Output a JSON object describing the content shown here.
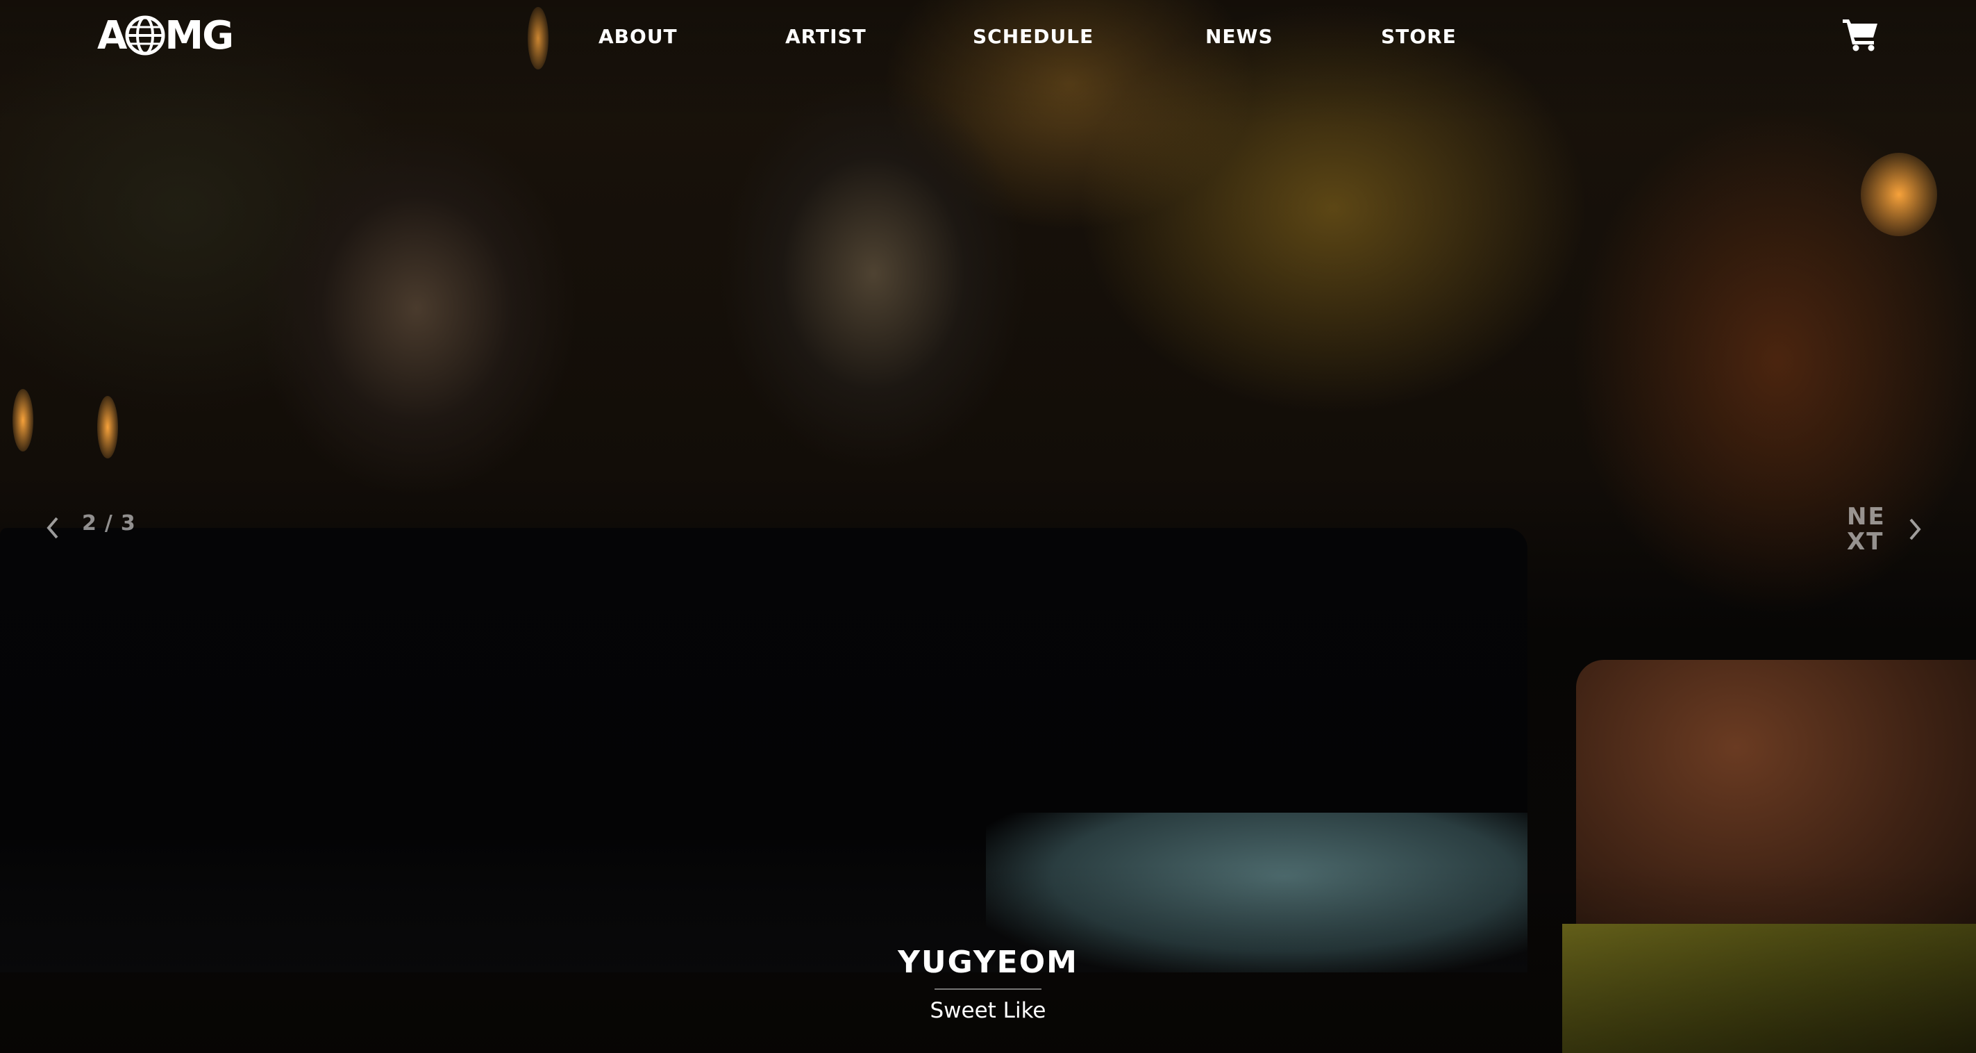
{
  "header": {
    "logo_text_left": "A",
    "logo_text_right": "MG",
    "nav": [
      {
        "label": "ABOUT"
      },
      {
        "label": "ARTIST"
      },
      {
        "label": "SCHEDULE"
      },
      {
        "label": "NEWS"
      },
      {
        "label": "STORE"
      }
    ],
    "cart_icon": "shopping-cart-icon"
  },
  "slider": {
    "current": "2",
    "separator": "/",
    "total": "3",
    "prev_icon": "chevron-left-icon",
    "next_label": "NEXT",
    "next_icon": "chevron-right-icon"
  },
  "caption": {
    "artist": "YUGYEOM",
    "title": "Sweet Like"
  },
  "colors": {
    "text": "#ffffff",
    "muted_text": "#8c8c8c",
    "background": "#070605"
  }
}
